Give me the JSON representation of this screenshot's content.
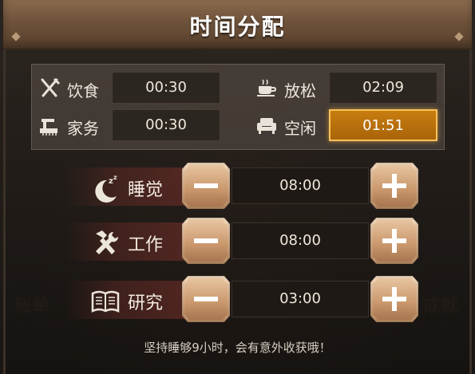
{
  "title": "时间分配",
  "summary": {
    "items": [
      {
        "icon": "fork-knife-icon",
        "label": "饮食",
        "value": "00:30",
        "active": false
      },
      {
        "icon": "coffee-cup-icon",
        "label": "放松",
        "value": "02:09",
        "active": false
      },
      {
        "icon": "broom-icon",
        "label": "家务",
        "value": "00:30",
        "active": false
      },
      {
        "icon": "armchair-icon",
        "label": "空闲",
        "value": "01:51",
        "active": true
      }
    ]
  },
  "activities": [
    {
      "icon": "moon-sleep-icon",
      "label": "睡觉",
      "value": "08:00"
    },
    {
      "icon": "hammer-wrench-icon",
      "label": "工作",
      "value": "08:00"
    },
    {
      "icon": "open-book-icon",
      "label": "研究",
      "value": "03:00"
    }
  ],
  "background_labels": {
    "left": "账单",
    "right": "成就"
  },
  "hint": "坚持睡够9小时，会有意外收获哦！",
  "colors": {
    "accent_gold": "#c87d10",
    "button_tan": "#d9b08a",
    "title_brown": "#6e523a",
    "label_red_band": "#6e2d28"
  }
}
